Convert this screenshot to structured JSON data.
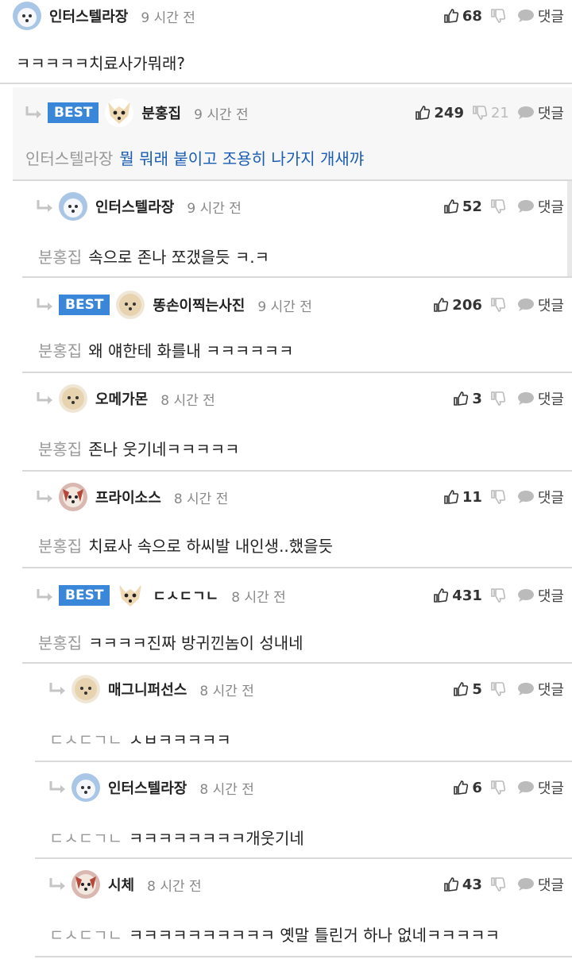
{
  "comments": [
    {
      "name": "인터스텔라장",
      "time": "9 시간 전",
      "likes": "68",
      "dislikes": "",
      "reply": "댓글",
      "mention": "",
      "text": "ㅋㅋㅋㅋㅋ치료사가뭐래?",
      "best": false,
      "avatar": "dog-white"
    },
    {
      "name": "분홍집",
      "time": "9 시간 전",
      "likes": "249",
      "dislikes": "21",
      "reply": "댓글",
      "mention": "인터스텔라장",
      "text": "뭘 뭐래 붙이고 조용히 나가지 개새꺄",
      "best": true,
      "avatar": "chihuahua"
    },
    {
      "name": "인터스텔라장",
      "time": "9 시간 전",
      "likes": "52",
      "dislikes": "",
      "reply": "댓글",
      "mention": "분홍집",
      "text": "속으로 존나 쪼갰을듯 ㅋ.ㅋ",
      "best": false,
      "avatar": "dog-white"
    },
    {
      "name": "똥손이찍는사진",
      "time": "9 시간 전",
      "likes": "206",
      "dislikes": "",
      "reply": "댓글",
      "mention": "분홍집",
      "text": "왜 얘한테 화를내 ㅋㅋㅋㅋㅋㅋ",
      "best": true,
      "avatar": "poodle"
    },
    {
      "name": "오메가몬",
      "time": "8 시간 전",
      "likes": "3",
      "dislikes": "",
      "reply": "댓글",
      "mention": "분홍집",
      "text": "존나 웃기네ㅋㅋㅋㅋㅋ",
      "best": false,
      "avatar": "poodle"
    },
    {
      "name": "프라이소스",
      "time": "8 시간 전",
      "likes": "11",
      "dislikes": "",
      "reply": "댓글",
      "mention": "분홍집",
      "text": "치료사 속으로 하씨발 내인생..했을듯",
      "best": false,
      "avatar": "red-dog"
    },
    {
      "name": "ㄷㅅㄷㄱㄴ",
      "time": "8 시간 전",
      "likes": "431",
      "dislikes": "",
      "reply": "댓글",
      "mention": "분홍집",
      "text": "ㅋㅋㅋㅋ진짜 방귀낀놈이 성내네",
      "best": true,
      "avatar": "chihuahua"
    },
    {
      "name": "매그니퍼선스",
      "time": "8 시간 전",
      "likes": "5",
      "dislikes": "",
      "reply": "댓글",
      "mention": "ㄷㅅㄷㄱㄴ",
      "text": "ㅅㅂㅋㅋㅋㅋㅋ",
      "best": false,
      "avatar": "poodle"
    },
    {
      "name": "인터스텔라장",
      "time": "8 시간 전",
      "likes": "6",
      "dislikes": "",
      "reply": "댓글",
      "mention": "ㄷㅅㄷㄱㄴ",
      "text": "ㅋㅋㅋㅋㅋㅋㅋㅋ개웃기네",
      "best": false,
      "avatar": "dog-white"
    },
    {
      "name": "시체",
      "time": "8 시간 전",
      "likes": "43",
      "dislikes": "",
      "reply": "댓글",
      "mention": "ㄷㅅㄷㄱㄴ",
      "text": "ㅋㅋㅋㅋㅋㅋㅋㅋㅋㅋ 옛말 틀린거 하나 없네ㅋㅋㅋㅋㅋ",
      "best": false,
      "avatar": "red-dog"
    }
  ],
  "badge_label": "BEST",
  "colors": {
    "accent": "#3a86d8",
    "mention": "#999999",
    "link": "#1a5db5"
  }
}
